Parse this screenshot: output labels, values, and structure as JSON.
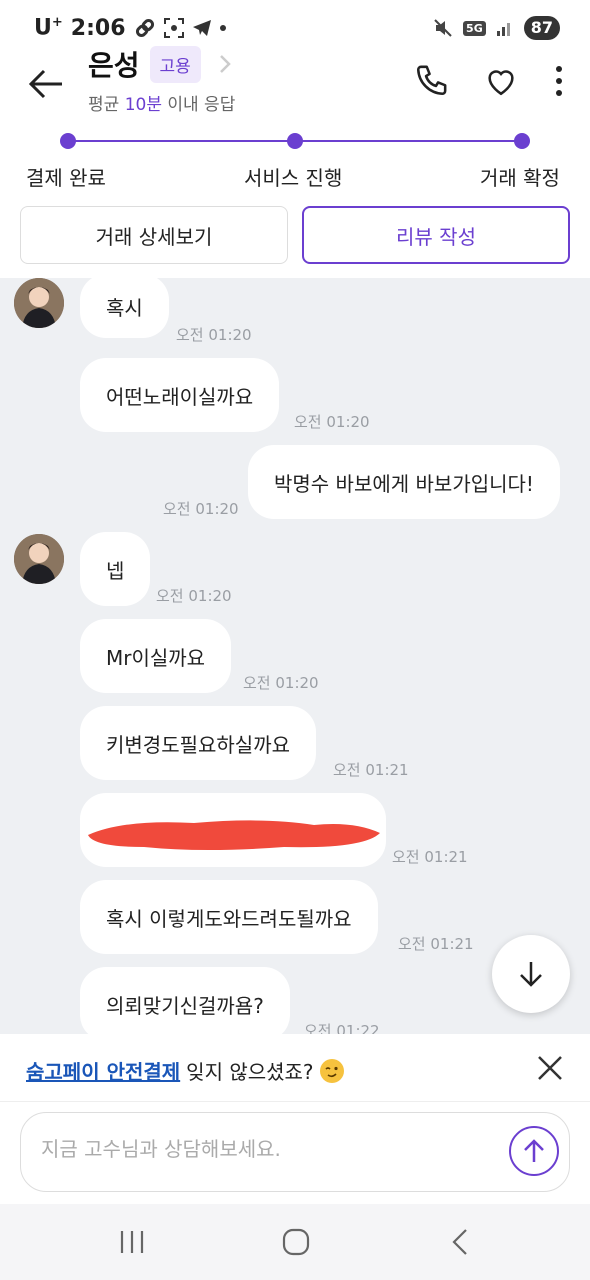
{
  "status_bar": {
    "carrier": "U",
    "carrier_sup": "+",
    "time": "2:06",
    "network": "5G",
    "battery": "87"
  },
  "header": {
    "title": "은성",
    "badge": "고용",
    "response_prefix": "평균 ",
    "response_highlight": "10분",
    "response_suffix": " 이내 응답"
  },
  "progress": {
    "steps": [
      "결제 완료",
      "서비스 진행",
      "거래 확정"
    ]
  },
  "actions": {
    "detail": "거래 상세보기",
    "review": "리뷰 작성"
  },
  "messages": [
    {
      "side": "left",
      "text": "혹시",
      "time": "오전 01:20"
    },
    {
      "side": "left",
      "text": "어떤노래이실까요",
      "time": "오전 01:20"
    },
    {
      "side": "right",
      "text": "박명수 바보에게 바보가입니다!",
      "time": "오전 01:20"
    },
    {
      "side": "left",
      "text": "넵",
      "time": "오전 01:20"
    },
    {
      "side": "left",
      "text": "Mr이실까요",
      "time": "오전 01:20"
    },
    {
      "side": "left",
      "text": "키변경도필요하실까요",
      "time": "오전 01:21"
    },
    {
      "side": "left",
      "text": "",
      "time": "오전 01:21",
      "redacted": true
    },
    {
      "side": "left",
      "text": "혹시 이렇게도와드려도될까요",
      "time": "오전 01:21"
    },
    {
      "side": "left",
      "text": "의뢰맞기신걸까욤?",
      "time": "오전 01:22"
    }
  ],
  "banner": {
    "link": "숨고페이 안전결제",
    "text": " 잊지 않으셨죠?"
  },
  "composer": {
    "placeholder": "지금 고수님과 상담해보세요."
  },
  "colors": {
    "accent": "#6b3fd0",
    "chat_bg": "#eef0f3",
    "link": "#1a56b8",
    "redaction": "#f04a3c"
  }
}
